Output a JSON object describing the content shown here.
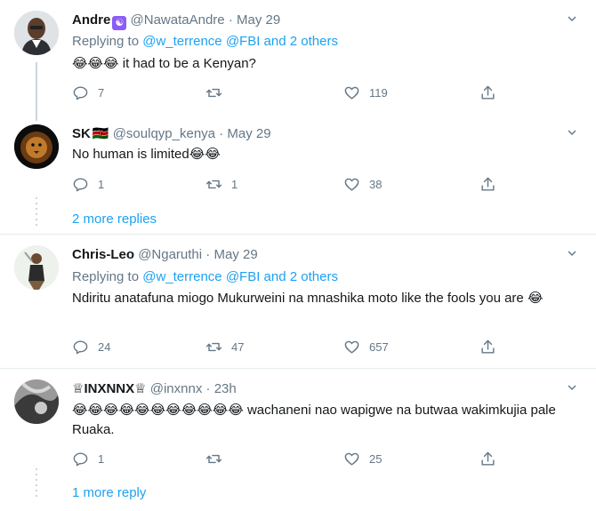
{
  "tweets": [
    {
      "name": "Andre",
      "name_badge": "☯",
      "handle": "@NawataAndre",
      "time": "May 29",
      "replying_label": "Replying to",
      "replying_targets": "@w_terrence @FBI and 2 others",
      "emoji_prefix": "😂😂😂",
      "text": " it had to be a Kenyan?",
      "replies": "7",
      "retweets": "",
      "likes": "119"
    },
    {
      "name": "SK",
      "name_badge": "🇰🇪",
      "handle": "@soulqyp_kenya",
      "time": "May 29",
      "text": "No human is limited",
      "emoji_suffix": "😂😂",
      "replies": "1",
      "retweets": "1",
      "likes": "38"
    },
    {
      "name": "Chris-Leo",
      "handle": "@Ngaruthi",
      "time": "May 29",
      "replying_label": "Replying to",
      "replying_targets": "@w_terrence @FBI and 2 others",
      "text": "Ndiritu anatafuna miogo Mukurweini na mnashika moto like the fools you are ",
      "emoji_suffix": "😂",
      "replies": "24",
      "retweets": "47",
      "likes": "657"
    },
    {
      "name": "♕INXNNX♕",
      "handle": "@inxnnx",
      "time": "23h",
      "emoji_prefix": "😂😂😂😂😂😂😂😂😂😂😂",
      "text": " wachaneni nao wapigwe na butwaa wakimkujia pale Ruaka.",
      "replies": "1",
      "retweets": "",
      "likes": "25"
    }
  ],
  "more_replies_1": "2 more replies",
  "more_replies_2": "1 more reply",
  "dot": "·",
  "colors": {
    "link": "#1da1f2",
    "muted": "#657786",
    "border": "#e6ecf0"
  }
}
